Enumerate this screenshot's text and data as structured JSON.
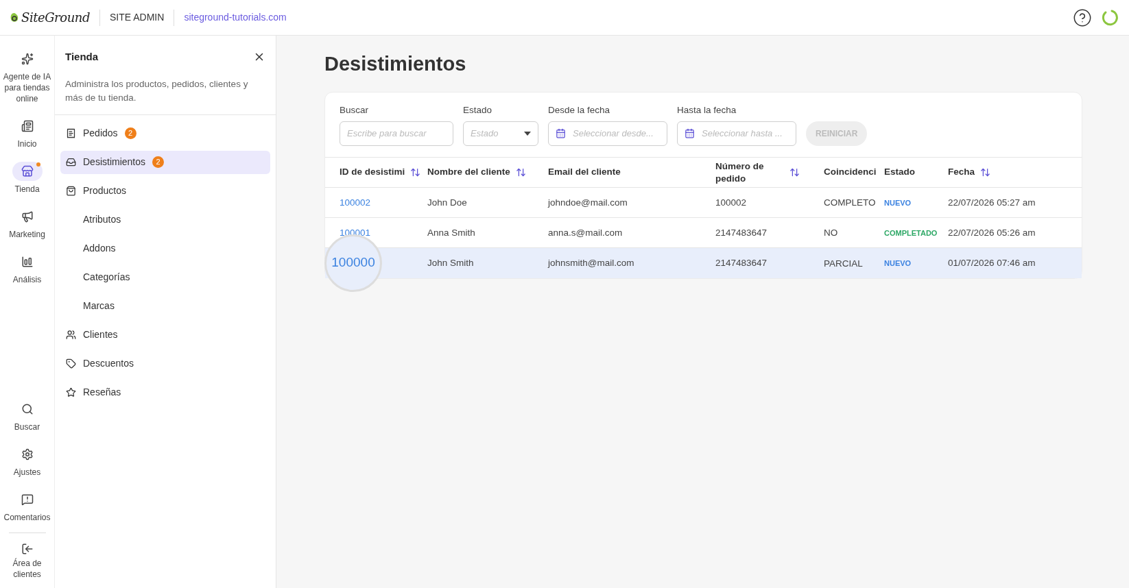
{
  "header": {
    "brand": "SiteGround",
    "section": "SITE ADMIN",
    "site": "siteground-tutorials.com"
  },
  "rail": {
    "top": [
      {
        "label": "Agente de IA para tiendas online",
        "selected": false,
        "dot": false
      },
      {
        "label": "Inicio",
        "selected": false,
        "dot": false
      },
      {
        "label": "Tienda",
        "selected": true,
        "dot": true
      },
      {
        "label": "Marketing",
        "selected": false,
        "dot": false
      },
      {
        "label": "Análisis",
        "selected": false,
        "dot": false
      }
    ],
    "bottom": [
      {
        "label": "Buscar",
        "selected": false,
        "dot": false
      },
      {
        "label": "Ajustes",
        "selected": false,
        "dot": false
      },
      {
        "label": "Comentarios",
        "selected": false,
        "dot": false
      }
    ],
    "footer": {
      "label": "Área de clientes"
    }
  },
  "panel": {
    "title": "Tienda",
    "description": "Administra los productos, pedidos, clientes y más de tu tienda.",
    "items": [
      {
        "label": "Pedidos",
        "badge": "2",
        "selected": false
      },
      {
        "label": "Desistimientos",
        "badge": "2",
        "selected": true
      },
      {
        "label": "Productos",
        "selected": false,
        "children": [
          {
            "label": "Atributos",
            "selected": false
          },
          {
            "label": "Addons",
            "selected": false
          },
          {
            "label": "Categorías",
            "selected": false
          },
          {
            "label": "Marcas",
            "selected": false
          }
        ]
      },
      {
        "label": "Clientes",
        "selected": false
      },
      {
        "label": "Descuentos",
        "selected": false
      },
      {
        "label": "Reseñas",
        "selected": false
      }
    ]
  },
  "page": {
    "title": "Desistimientos"
  },
  "filters": {
    "search": {
      "label": "Buscar",
      "placeholder": "Escribe para buscar"
    },
    "status": {
      "label": "Estado",
      "placeholder": "Estado"
    },
    "from": {
      "label": "Desde la fecha",
      "placeholder": "Seleccionar desde..."
    },
    "to": {
      "label": "Hasta la fecha",
      "placeholder": "Seleccionar hasta ..."
    },
    "reset": {
      "label": "REINICIAR",
      "disabled": true
    }
  },
  "table": {
    "columns": [
      {
        "label": "ID de desistimi",
        "sortable": true
      },
      {
        "label": "Nombre del cliente",
        "sortable": true
      },
      {
        "label": "Email del cliente",
        "sortable": false
      },
      {
        "label": "Número de pedido",
        "sortable": true
      },
      {
        "label": "Coincidenci",
        "sortable": false
      },
      {
        "label": "Estado",
        "sortable": false
      },
      {
        "label": "Fecha",
        "sortable": true
      }
    ],
    "rows": [
      {
        "id": "100002",
        "name": "John Doe",
        "email": "johndoe@mail.com",
        "order": "100002",
        "match": "COMPLETO",
        "status": {
          "label": "NUEVO",
          "kind": "new"
        },
        "date": "22/07/2026 05:27 am",
        "selected": false,
        "magnified": false
      },
      {
        "id": "100001",
        "name": "Anna Smith",
        "email": "anna.s@mail.com",
        "order": "2147483647",
        "match": "NO",
        "status": {
          "label": "COMPLETADO",
          "kind": "done"
        },
        "date": "22/07/2026 05:26 am",
        "selected": false,
        "magnified": false
      },
      {
        "id": "100000",
        "name": "John Smith",
        "email": "johnsmith@mail.com",
        "order": "2147483647",
        "match": "PARCIAL",
        "status": {
          "label": "NUEVO",
          "kind": "new"
        },
        "date": "01/07/2026 07:46 am",
        "selected": true,
        "magnified": true
      }
    ]
  }
}
